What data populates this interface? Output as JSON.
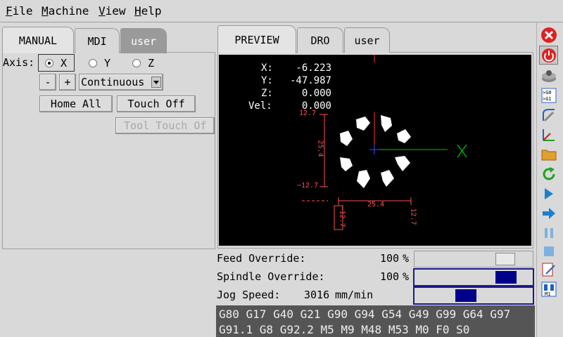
{
  "menu": {
    "file_first": "F",
    "file_rest": "ile",
    "machine_first": "M",
    "machine_rest": "achine",
    "view_first": "V",
    "view_rest": "iew",
    "help_first": "H",
    "help_rest": "elp"
  },
  "left_tabs": [
    "MANUAL",
    "MDI",
    "user"
  ],
  "right_tabs": [
    "PREVIEW",
    "DRO",
    "user"
  ],
  "axis": {
    "label": "Axis:",
    "options": [
      "X",
      "Y",
      "Z"
    ],
    "selected": "X"
  },
  "jog": {
    "minus": "-",
    "plus": "+",
    "mode": "Continuous"
  },
  "buttons": {
    "home_all": "Home All",
    "touch_off": "Touch Off",
    "tool_touch_off": "Tool Touch Of"
  },
  "dro": {
    "x_label": "X:",
    "x_value": "-6.223",
    "y_label": "Y:",
    "y_value": "-47.987",
    "z_label": "Z:",
    "z_value": "0.000",
    "vel_label": "Vel:",
    "vel_value": "0.000"
  },
  "preview": {
    "dim_top": "12.7",
    "dim_mid_v": "25.4",
    "dim_bottom": "−12.7",
    "dim_h": "25.4",
    "dim_left": "−12.7",
    "dim_right": "12.7",
    "axis_x": "X",
    "colors": {
      "dims": "#ff5050",
      "x_axis": "#00cc00",
      "tool": "#ff3030"
    }
  },
  "overrides": {
    "feed_label": "Feed Override:",
    "feed_value": "100",
    "feed_unit": "%",
    "spindle_label": "Spindle Override:",
    "spindle_value": "100",
    "spindle_unit": "%",
    "jog_label": "Jog Speed:",
    "jog_value": "3016",
    "jog_unit": "mm/min"
  },
  "gcode": {
    "line1": "G80 G17 G40 G21 G90 G94 G54 G49 G99 G64 G97",
    "line2": "G91.1 G8 G92.2 M5 M9 M48 M53 M0 F0 S0"
  },
  "toolbar_icons": [
    "estop-icon",
    "power-icon",
    "home-icon",
    "offsets-icon",
    "touch-icon",
    "axes-icon",
    "open-file-icon",
    "reload-icon",
    "run-icon",
    "step-icon",
    "pause-icon",
    "stop-icon",
    "edit-icon",
    "mdi-icon"
  ],
  "toolbar_labels": {
    "offsets_top": ">G0",
    "offsets_bottom": ">G1",
    "mdi": "M1"
  }
}
